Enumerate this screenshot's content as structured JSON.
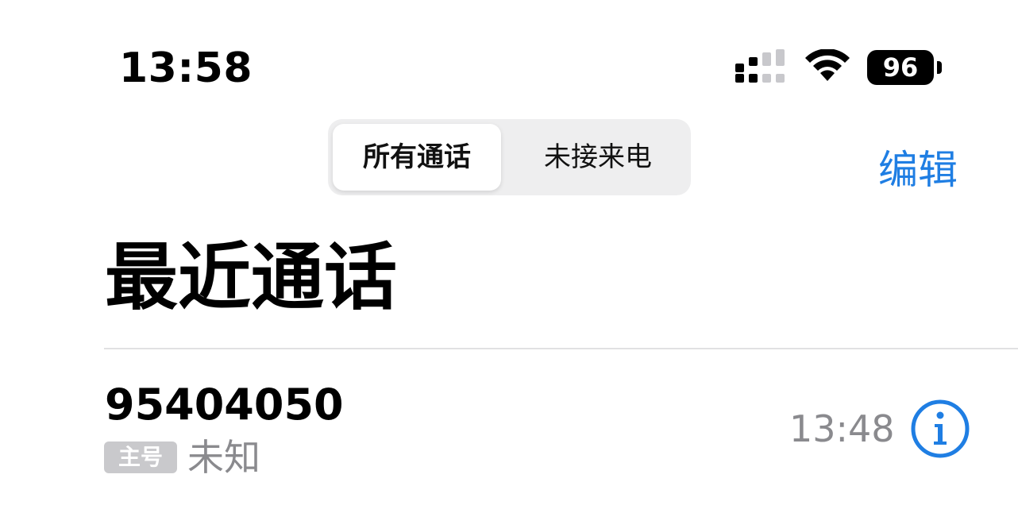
{
  "status_bar": {
    "time": "13:58",
    "battery_level": "96",
    "signal_icon": "cellular-signal-icon",
    "wifi_icon": "wifi-icon"
  },
  "segmented": {
    "all_label": "所有通话",
    "missed_label": "未接来电",
    "selected": "all"
  },
  "nav": {
    "edit_label": "编辑"
  },
  "page": {
    "title": "最近通话"
  },
  "calls": [
    {
      "number": "95404050",
      "line_badge": "主号",
      "type": "未知",
      "time": "13:48",
      "info_icon": "info-circle-icon"
    }
  ],
  "colors": {
    "accent": "#1f7ee3",
    "secondary_text": "#8a8a8e",
    "badge_bg": "#c9c9cc",
    "segmented_bg": "#eeeeef"
  }
}
